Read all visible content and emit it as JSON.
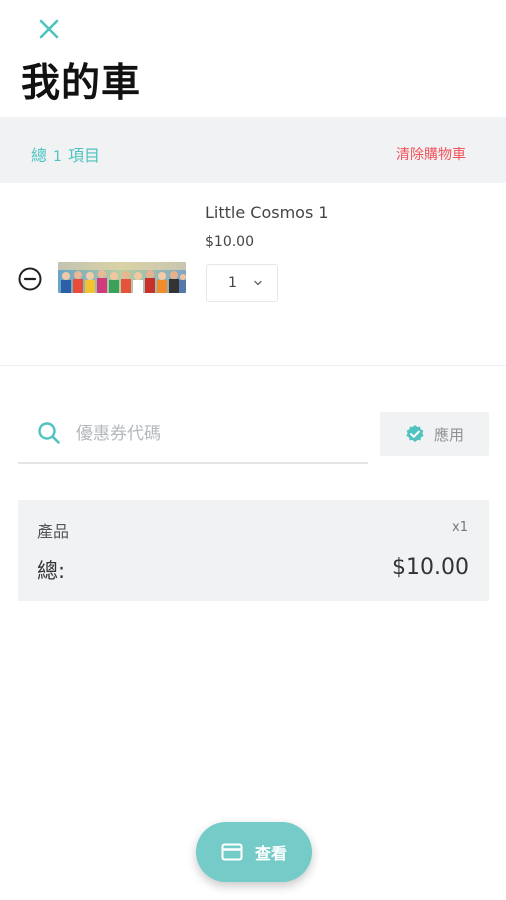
{
  "header": {
    "title": "我的車"
  },
  "summary": {
    "count_prefix": "總",
    "count_number": "1",
    "count_suffix": "項目",
    "clear_cart": "清除購物車"
  },
  "cart": {
    "items": [
      {
        "name": "Little Cosmos 1",
        "price": "$10.00",
        "quantity": "1"
      }
    ]
  },
  "coupon": {
    "placeholder": "優惠券代碼",
    "value": "",
    "apply_label": "應用"
  },
  "totals": {
    "product_label": "產品",
    "product_qty": "x1",
    "total_label": "總:",
    "total_value": "$10.00"
  },
  "checkout": {
    "label": "查看"
  },
  "colors": {
    "accent": "#4ec3c0",
    "checkout_button": "#74cbc8",
    "danger": "#f2545b",
    "panel": "#f0f2f4"
  },
  "icons": {
    "close": "close-icon",
    "remove": "minus-circle-icon",
    "quantity": "chevron-down-icon",
    "search": "search-icon",
    "apply": "verified-badge-icon",
    "checkout": "credit-card-icon"
  }
}
